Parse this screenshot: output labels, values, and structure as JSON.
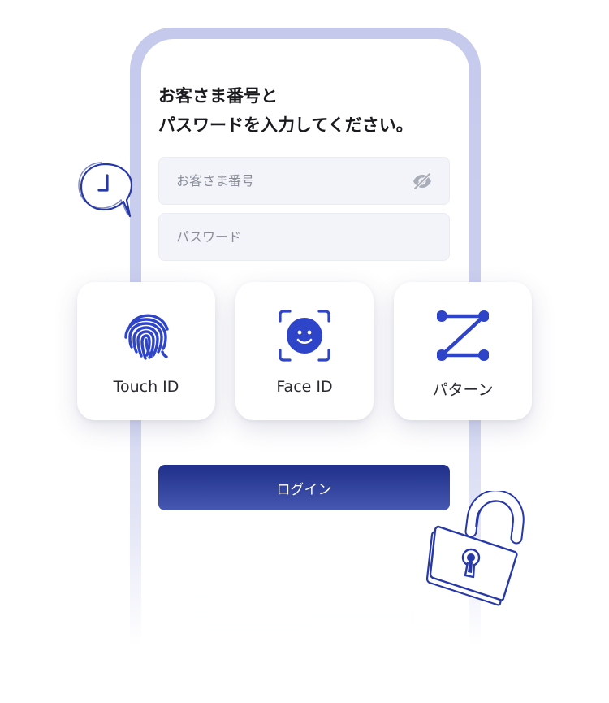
{
  "heading": {
    "line1": "お客さま番号と",
    "line2": "パスワードを入力してください。"
  },
  "fields": {
    "customer_number_placeholder": "お客さま番号",
    "password_placeholder": "パスワード"
  },
  "auth_options": [
    {
      "label": "Touch ID",
      "icon": "fingerprint-icon"
    },
    {
      "label": "Face ID",
      "icon": "face-id-icon"
    },
    {
      "label": "パターン",
      "icon": "pattern-icon"
    }
  ],
  "login_button": "ログイン",
  "colors": {
    "accent": "#2e44c9",
    "button_top": "#1f2f8a",
    "button_bottom": "#4658b2",
    "frame": "#c5c9ec",
    "field_bg": "#f2f4f9"
  }
}
